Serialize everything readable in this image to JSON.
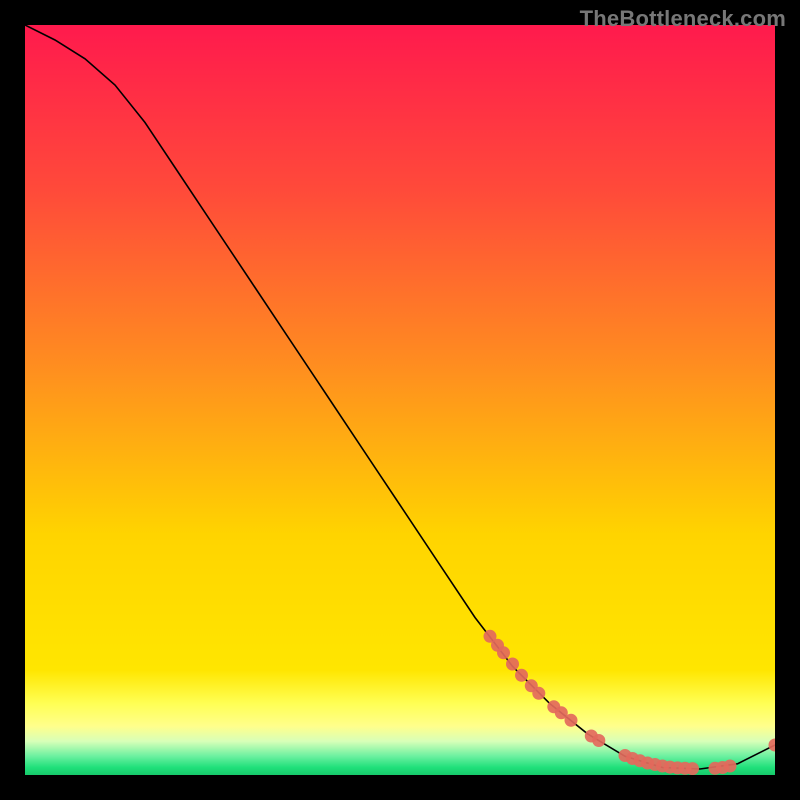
{
  "watermark": "TheBottleneck.com",
  "colors": {
    "bg_black": "#000000",
    "grad_top": "#ff1a4d",
    "grad_mid1": "#ff6a2a",
    "grad_mid2": "#ffd400",
    "grad_band_yellow": "#ffff55",
    "grad_band_pale": "#d8ffb8",
    "grad_band_green": "#1fe07a",
    "curve": "#000000",
    "marker": "#e3695c"
  },
  "chart_data": {
    "type": "line",
    "title": "",
    "xlabel": "",
    "ylabel": "",
    "xlim": [
      0,
      100
    ],
    "ylim": [
      0,
      100
    ],
    "annotations": [],
    "curve": [
      {
        "x": 0,
        "y": 100
      },
      {
        "x": 4,
        "y": 98
      },
      {
        "x": 8,
        "y": 95.5
      },
      {
        "x": 12,
        "y": 92
      },
      {
        "x": 16,
        "y": 87
      },
      {
        "x": 20,
        "y": 81
      },
      {
        "x": 25,
        "y": 73.5
      },
      {
        "x": 30,
        "y": 66
      },
      {
        "x": 35,
        "y": 58.5
      },
      {
        "x": 40,
        "y": 51
      },
      {
        "x": 45,
        "y": 43.5
      },
      {
        "x": 50,
        "y": 36
      },
      {
        "x": 55,
        "y": 28.5
      },
      {
        "x": 60,
        "y": 21
      },
      {
        "x": 65,
        "y": 14.5
      },
      {
        "x": 70,
        "y": 9.5
      },
      {
        "x": 75,
        "y": 5.5
      },
      {
        "x": 80,
        "y": 2.5
      },
      {
        "x": 85,
        "y": 1.0
      },
      {
        "x": 90,
        "y": 0.8
      },
      {
        "x": 95,
        "y": 1.5
      },
      {
        "x": 100,
        "y": 4.0
      }
    ],
    "marker_clusters": [
      {
        "x": 62,
        "y": 18.5
      },
      {
        "x": 63,
        "y": 17.3
      },
      {
        "x": 63.8,
        "y": 16.3
      },
      {
        "x": 65,
        "y": 14.8
      },
      {
        "x": 66.2,
        "y": 13.3
      },
      {
        "x": 67.5,
        "y": 11.9
      },
      {
        "x": 68.5,
        "y": 10.9
      },
      {
        "x": 70.5,
        "y": 9.1
      },
      {
        "x": 71.5,
        "y": 8.3
      },
      {
        "x": 72.8,
        "y": 7.3
      },
      {
        "x": 75.5,
        "y": 5.2
      },
      {
        "x": 76.5,
        "y": 4.6
      },
      {
        "x": 80,
        "y": 2.6
      },
      {
        "x": 81,
        "y": 2.2
      },
      {
        "x": 82,
        "y": 1.9
      },
      {
        "x": 83,
        "y": 1.6
      },
      {
        "x": 84,
        "y": 1.4
      },
      {
        "x": 85,
        "y": 1.2
      },
      {
        "x": 86,
        "y": 1.05
      },
      {
        "x": 87,
        "y": 0.95
      },
      {
        "x": 88,
        "y": 0.9
      },
      {
        "x": 89,
        "y": 0.85
      },
      {
        "x": 92,
        "y": 0.9
      },
      {
        "x": 93,
        "y": 1.0
      },
      {
        "x": 94,
        "y": 1.2
      },
      {
        "x": 100,
        "y": 4.0
      }
    ]
  }
}
